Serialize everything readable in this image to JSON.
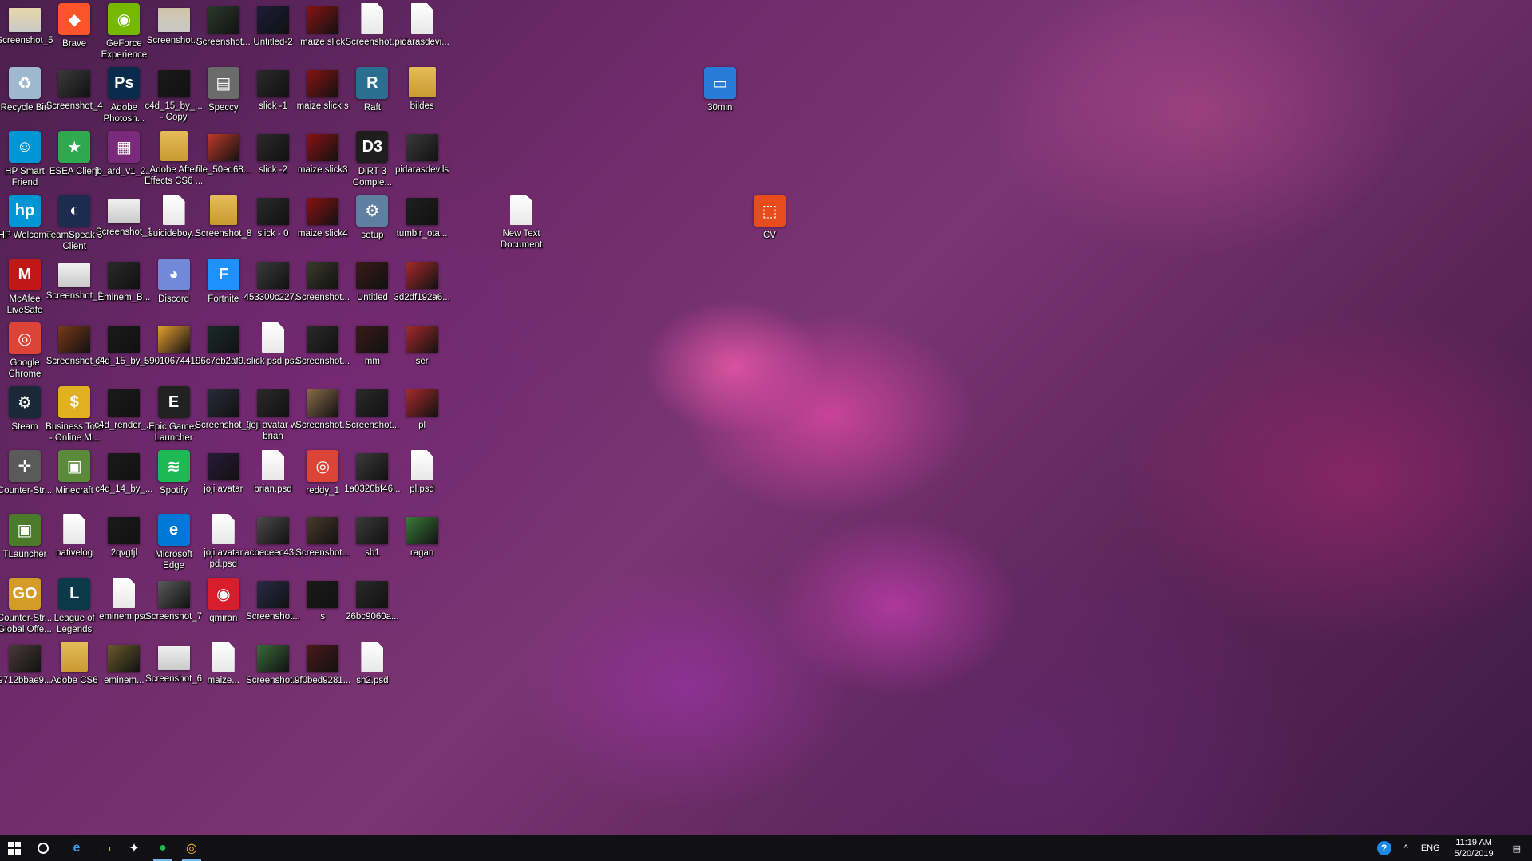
{
  "desktop": {
    "icons": [
      {
        "label": "Screenshot_5",
        "kind": "shot",
        "glyph": "",
        "color": "#e8d7a9",
        "col": 0,
        "row": 0,
        "shortcut": false
      },
      {
        "label": "Brave",
        "kind": "app",
        "glyph": "◆",
        "color": "#fb542b",
        "col": 1,
        "row": 0,
        "shortcut": true
      },
      {
        "label": "GeForce Experience",
        "kind": "app",
        "glyph": "◉",
        "color": "#76b900",
        "col": 2,
        "row": 0,
        "shortcut": true
      },
      {
        "label": "Screenshot...",
        "kind": "shot",
        "glyph": "",
        "color": "#cfc6a8",
        "col": 3,
        "row": 0,
        "shortcut": false
      },
      {
        "label": "Screenshot...",
        "kind": "img",
        "glyph": "",
        "color": "#2b3a2b",
        "col": 4,
        "row": 0,
        "shortcut": false
      },
      {
        "label": "Untitled-2",
        "kind": "img",
        "glyph": "",
        "color": "#1c1c3a",
        "col": 5,
        "row": 0,
        "shortcut": false
      },
      {
        "label": "maize slick",
        "kind": "img",
        "glyph": "",
        "color": "#8a1212",
        "col": 6,
        "row": 0,
        "shortcut": false
      },
      {
        "label": "Screenshot...",
        "kind": "doc",
        "glyph": "",
        "color": "#ffffff",
        "col": 7,
        "row": 0,
        "shortcut": false
      },
      {
        "label": "pidarasdevi...",
        "kind": "doc",
        "glyph": "",
        "color": "#ffffff",
        "col": 8,
        "row": 0,
        "shortcut": false
      },
      {
        "label": "Recycle Bin",
        "kind": "app",
        "glyph": "♻",
        "color": "#9fb7cf",
        "col": 0,
        "row": 1,
        "shortcut": false
      },
      {
        "label": "Screenshot_4",
        "kind": "img",
        "glyph": "",
        "color": "#3a3a3a",
        "col": 1,
        "row": 1,
        "shortcut": false
      },
      {
        "label": "Adobe Photosh...",
        "kind": "app",
        "glyph": "Ps",
        "color": "#0b2b4c",
        "col": 2,
        "row": 1,
        "shortcut": true
      },
      {
        "label": "c4d_15_by_... - Copy",
        "kind": "img",
        "glyph": "",
        "color": "#1a1a1a",
        "col": 3,
        "row": 1,
        "shortcut": false
      },
      {
        "label": "Speccy",
        "kind": "app",
        "glyph": "▤",
        "color": "#6b6b6b",
        "col": 4,
        "row": 1,
        "shortcut": true
      },
      {
        "label": "slick -1",
        "kind": "img",
        "glyph": "",
        "color": "#2a2a2a",
        "col": 5,
        "row": 1,
        "shortcut": false
      },
      {
        "label": "maize slick s",
        "kind": "img",
        "glyph": "",
        "color": "#8a1212",
        "col": 6,
        "row": 1,
        "shortcut": false
      },
      {
        "label": "Raft",
        "kind": "app",
        "glyph": "R",
        "color": "#2a6f8f",
        "col": 7,
        "row": 1,
        "shortcut": true
      },
      {
        "label": "bildes",
        "kind": "folder",
        "glyph": "",
        "color": "#e5bd5a",
        "col": 8,
        "row": 1,
        "shortcut": false
      },
      {
        "label": "HP Smart Friend",
        "kind": "app",
        "glyph": "☺",
        "color": "#0096d6",
        "col": 0,
        "row": 2,
        "shortcut": true
      },
      {
        "label": "ESEA Client",
        "kind": "app",
        "glyph": "★",
        "color": "#2fa84f",
        "col": 1,
        "row": 2,
        "shortcut": true
      },
      {
        "label": "jb_ard_v1_2...",
        "kind": "app",
        "glyph": "▦",
        "color": "#7a2a7a",
        "col": 2,
        "row": 2,
        "shortcut": false
      },
      {
        "label": "Adobe After Effects CS6 ...",
        "kind": "folder",
        "glyph": "",
        "color": "#e5bd5a",
        "col": 3,
        "row": 2,
        "shortcut": false
      },
      {
        "label": "file_50ed68...",
        "kind": "img",
        "glyph": "",
        "color": "#c0392b",
        "col": 4,
        "row": 2,
        "shortcut": false
      },
      {
        "label": "slick -2",
        "kind": "img",
        "glyph": "",
        "color": "#2a2a2a",
        "col": 5,
        "row": 2,
        "shortcut": false
      },
      {
        "label": "maize slick3",
        "kind": "img",
        "glyph": "",
        "color": "#8a1212",
        "col": 6,
        "row": 2,
        "shortcut": false
      },
      {
        "label": "DiRT 3 Comple...",
        "kind": "app",
        "glyph": "D3",
        "color": "#1e1e1e",
        "col": 7,
        "row": 2,
        "shortcut": true
      },
      {
        "label": "pidarasdevils",
        "kind": "img",
        "glyph": "",
        "color": "#3a3a3a",
        "col": 8,
        "row": 2,
        "shortcut": false
      },
      {
        "label": "HP Welcome",
        "kind": "app",
        "glyph": "hp",
        "color": "#0096d6",
        "col": 0,
        "row": 3,
        "shortcut": true
      },
      {
        "label": "TeamSpeak 3 Client",
        "kind": "app",
        "glyph": "◐",
        "color": "#1b2c4e",
        "col": 1,
        "row": 3,
        "shortcut": true
      },
      {
        "label": "Screenshot_1",
        "kind": "shot",
        "glyph": "",
        "color": "#f0f0f0",
        "col": 2,
        "row": 3,
        "shortcut": false
      },
      {
        "label": "suicideboy...",
        "kind": "doc",
        "glyph": "",
        "color": "#ffffff",
        "col": 3,
        "row": 3,
        "shortcut": false
      },
      {
        "label": "Screenshot_8",
        "kind": "folder",
        "glyph": "",
        "color": "#e5bd5a",
        "col": 4,
        "row": 3,
        "shortcut": false
      },
      {
        "label": "slick - 0",
        "kind": "img",
        "glyph": "",
        "color": "#2a2a2a",
        "col": 5,
        "row": 3,
        "shortcut": false
      },
      {
        "label": "maize slick4",
        "kind": "img",
        "glyph": "",
        "color": "#8a1212",
        "col": 6,
        "row": 3,
        "shortcut": false
      },
      {
        "label": "setup",
        "kind": "app",
        "glyph": "⚙",
        "color": "#5f7fa0",
        "col": 7,
        "row": 3,
        "shortcut": true
      },
      {
        "label": "tumblr_ota...",
        "kind": "img",
        "glyph": "",
        "color": "#1f1f1f",
        "col": 8,
        "row": 3,
        "shortcut": false
      },
      {
        "label": "McAfee LiveSafe",
        "kind": "app",
        "glyph": "M",
        "color": "#c01818",
        "col": 0,
        "row": 4,
        "shortcut": true
      },
      {
        "label": "Screenshot_2",
        "kind": "shot",
        "glyph": "",
        "color": "#f0f0f0",
        "col": 1,
        "row": 4,
        "shortcut": false
      },
      {
        "label": "Eminem_B...",
        "kind": "img",
        "glyph": "",
        "color": "#2a2a2a",
        "col": 2,
        "row": 4,
        "shortcut": false
      },
      {
        "label": "Discord",
        "kind": "app",
        "glyph": "◕",
        "color": "#7289da",
        "col": 3,
        "row": 4,
        "shortcut": true
      },
      {
        "label": "Fortnite",
        "kind": "app",
        "glyph": "F",
        "color": "#1e90ff",
        "col": 4,
        "row": 4,
        "shortcut": true
      },
      {
        "label": "453300c227...",
        "kind": "img",
        "glyph": "",
        "color": "#3a3a3a",
        "col": 5,
        "row": 4,
        "shortcut": false
      },
      {
        "label": "Screenshot...",
        "kind": "img",
        "glyph": "",
        "color": "#3a3a2a",
        "col": 6,
        "row": 4,
        "shortcut": false
      },
      {
        "label": "Untitled",
        "kind": "img",
        "glyph": "",
        "color": "#3a1a1a",
        "col": 7,
        "row": 4,
        "shortcut": false
      },
      {
        "label": "3d2df192a6...",
        "kind": "img",
        "glyph": "",
        "color": "#a52a2a",
        "col": 8,
        "row": 4,
        "shortcut": false
      },
      {
        "label": "Google Chrome",
        "kind": "app",
        "glyph": "◎",
        "color": "#db4437",
        "col": 0,
        "row": 5,
        "shortcut": true
      },
      {
        "label": "Screenshot_3",
        "kind": "img",
        "glyph": "",
        "color": "#7a3a1a",
        "col": 1,
        "row": 5,
        "shortcut": false
      },
      {
        "label": "c4d_15_by_...",
        "kind": "img",
        "glyph": "",
        "color": "#1a1a1a",
        "col": 2,
        "row": 5,
        "shortcut": false
      },
      {
        "label": "5901067441...",
        "kind": "img",
        "glyph": "",
        "color": "#e8a030",
        "col": 3,
        "row": 5,
        "shortcut": false
      },
      {
        "label": "96c7eb2af9...",
        "kind": "img",
        "glyph": "",
        "color": "#1a2a2a",
        "col": 4,
        "row": 5,
        "shortcut": false
      },
      {
        "label": "slick psd.psd",
        "kind": "doc",
        "glyph": "",
        "color": "#ffffff",
        "col": 5,
        "row": 5,
        "shortcut": false
      },
      {
        "label": "Screenshot...",
        "kind": "img",
        "glyph": "",
        "color": "#2a2a2a",
        "col": 6,
        "row": 5,
        "shortcut": false
      },
      {
        "label": "mm",
        "kind": "img",
        "glyph": "",
        "color": "#3a1a1a",
        "col": 7,
        "row": 5,
        "shortcut": false
      },
      {
        "label": "ser",
        "kind": "img",
        "glyph": "",
        "color": "#a52a2a",
        "col": 8,
        "row": 5,
        "shortcut": false
      },
      {
        "label": "Steam",
        "kind": "app",
        "glyph": "⚙",
        "color": "#1b2838",
        "col": 0,
        "row": 6,
        "shortcut": true
      },
      {
        "label": "Business Tour - Online M...",
        "kind": "app",
        "glyph": "$",
        "color": "#e0b020",
        "col": 1,
        "row": 6,
        "shortcut": true
      },
      {
        "label": "c4d_render_...",
        "kind": "img",
        "glyph": "",
        "color": "#1a1a1a",
        "col": 2,
        "row": 6,
        "shortcut": false
      },
      {
        "label": "Epic Games Launcher",
        "kind": "app",
        "glyph": "E",
        "color": "#222222",
        "col": 3,
        "row": 6,
        "shortcut": true
      },
      {
        "label": "Screenshot_9",
        "kind": "img",
        "glyph": "",
        "color": "#2a2a3a",
        "col": 4,
        "row": 6,
        "shortcut": false
      },
      {
        "label": "joji avatar w brian",
        "kind": "img",
        "glyph": "",
        "color": "#2a2a2a",
        "col": 5,
        "row": 6,
        "shortcut": false
      },
      {
        "label": "Screenshot...",
        "kind": "img",
        "glyph": "",
        "color": "#8a6a4a",
        "col": 6,
        "row": 6,
        "shortcut": false
      },
      {
        "label": "Screenshot...",
        "kind": "img",
        "glyph": "",
        "color": "#2a2a2a",
        "col": 7,
        "row": 6,
        "shortcut": false
      },
      {
        "label": "pl",
        "kind": "img",
        "glyph": "",
        "color": "#a52a2a",
        "col": 8,
        "row": 6,
        "shortcut": false
      },
      {
        "label": "Counter-Str...",
        "kind": "app",
        "glyph": "✛",
        "color": "#5a5a5a",
        "col": 0,
        "row": 7,
        "shortcut": true
      },
      {
        "label": "Minecraft",
        "kind": "app",
        "glyph": "▣",
        "color": "#5a8a3a",
        "col": 1,
        "row": 7,
        "shortcut": true
      },
      {
        "label": "c4d_14_by_...",
        "kind": "img",
        "glyph": "",
        "color": "#1a1a1a",
        "col": 2,
        "row": 7,
        "shortcut": false
      },
      {
        "label": "Spotify",
        "kind": "app",
        "glyph": "≋",
        "color": "#1db954",
        "col": 3,
        "row": 7,
        "shortcut": true
      },
      {
        "label": "joji avatar",
        "kind": "img",
        "glyph": "",
        "color": "#2a1a3a",
        "col": 4,
        "row": 7,
        "shortcut": false
      },
      {
        "label": "brian.psd",
        "kind": "doc",
        "glyph": "",
        "color": "#ffffff",
        "col": 5,
        "row": 7,
        "shortcut": false
      },
      {
        "label": "reddy_1",
        "kind": "app",
        "glyph": "◎",
        "color": "#db4437",
        "col": 6,
        "row": 7,
        "shortcut": false
      },
      {
        "label": "1a0320bf46...",
        "kind": "img",
        "glyph": "",
        "color": "#3a3a3a",
        "col": 7,
        "row": 7,
        "shortcut": false
      },
      {
        "label": "pl.psd",
        "kind": "doc",
        "glyph": "",
        "color": "#ffffff",
        "col": 8,
        "row": 7,
        "shortcut": false
      },
      {
        "label": "TLauncher",
        "kind": "app",
        "glyph": "▣",
        "color": "#4a7a2a",
        "col": 0,
        "row": 8,
        "shortcut": true
      },
      {
        "label": "nativelog",
        "kind": "doc",
        "glyph": "",
        "color": "#ffffff",
        "col": 1,
        "row": 8,
        "shortcut": false
      },
      {
        "label": "2qvgtjl",
        "kind": "img",
        "glyph": "",
        "color": "#1a1a1a",
        "col": 2,
        "row": 8,
        "shortcut": false
      },
      {
        "label": "Microsoft Edge",
        "kind": "app",
        "glyph": "e",
        "color": "#0078d7",
        "col": 3,
        "row": 8,
        "shortcut": true
      },
      {
        "label": "joji avatar pd.psd",
        "kind": "doc",
        "glyph": "",
        "color": "#ffffff",
        "col": 4,
        "row": 8,
        "shortcut": false
      },
      {
        "label": "acbeceec43...",
        "kind": "img",
        "glyph": "",
        "color": "#4a4a4a",
        "col": 5,
        "row": 8,
        "shortcut": false
      },
      {
        "label": "Screenshot...",
        "kind": "img",
        "glyph": "",
        "color": "#4a3a2a",
        "col": 6,
        "row": 8,
        "shortcut": false
      },
      {
        "label": "sb1",
        "kind": "img",
        "glyph": "",
        "color": "#3a3a3a",
        "col": 7,
        "row": 8,
        "shortcut": false
      },
      {
        "label": "ragan",
        "kind": "img",
        "glyph": "",
        "color": "#3a7a3a",
        "col": 8,
        "row": 8,
        "shortcut": false
      },
      {
        "label": "Counter-Str... Global Offe...",
        "kind": "app",
        "glyph": "GO",
        "color": "#d49a2a",
        "col": 0,
        "row": 9,
        "shortcut": true
      },
      {
        "label": "League of Legends",
        "kind": "app",
        "glyph": "L",
        "color": "#0a3a4a",
        "col": 1,
        "row": 9,
        "shortcut": true
      },
      {
        "label": "eminem.psd",
        "kind": "doc",
        "glyph": "",
        "color": "#ffffff",
        "col": 2,
        "row": 9,
        "shortcut": false
      },
      {
        "label": "Screenshot_7",
        "kind": "img",
        "glyph": "",
        "color": "#5a5a5a",
        "col": 3,
        "row": 9,
        "shortcut": false
      },
      {
        "label": "qmiran",
        "kind": "app",
        "glyph": "◉",
        "color": "#d81e2a",
        "col": 4,
        "row": 9,
        "shortcut": false
      },
      {
        "label": "Screenshot...",
        "kind": "img",
        "glyph": "",
        "color": "#2a2a4a",
        "col": 5,
        "row": 9,
        "shortcut": false
      },
      {
        "label": "s",
        "kind": "img",
        "glyph": "",
        "color": "#1a1a1a",
        "col": 6,
        "row": 9,
        "shortcut": false
      },
      {
        "label": "26bc9060a...",
        "kind": "img",
        "glyph": "",
        "color": "#2a2a2a",
        "col": 7,
        "row": 9,
        "shortcut": false
      },
      {
        "label": "9712bbae9...",
        "kind": "img",
        "glyph": "",
        "color": "#4a3a3a",
        "col": 0,
        "row": 10,
        "shortcut": false
      },
      {
        "label": "Adobe CS6",
        "kind": "folder",
        "glyph": "",
        "color": "#e5bd5a",
        "col": 1,
        "row": 10,
        "shortcut": false
      },
      {
        "label": "eminem...",
        "kind": "img",
        "glyph": "",
        "color": "#6a5a2a",
        "col": 2,
        "row": 10,
        "shortcut": false
      },
      {
        "label": "Screenshot_6",
        "kind": "shot",
        "glyph": "",
        "color": "#f0f0f0",
        "col": 3,
        "row": 10,
        "shortcut": false
      },
      {
        "label": "maize...",
        "kind": "doc",
        "glyph": "",
        "color": "#ffffff",
        "col": 4,
        "row": 10,
        "shortcut": false
      },
      {
        "label": "Screenshot...",
        "kind": "img",
        "glyph": "",
        "color": "#3a6a3a",
        "col": 5,
        "row": 10,
        "shortcut": false
      },
      {
        "label": "9f0bed9281...",
        "kind": "img",
        "glyph": "",
        "color": "#4a1a1a",
        "col": 6,
        "row": 10,
        "shortcut": false
      },
      {
        "label": "sh2.psd",
        "kind": "doc",
        "glyph": "",
        "color": "#ffffff",
        "col": 7,
        "row": 10,
        "shortcut": false
      },
      {
        "label": "New Text Document",
        "kind": "doc",
        "glyph": "",
        "color": "#ffffff",
        "col": 10,
        "row": 3,
        "shortcut": false
      },
      {
        "label": "30min",
        "kind": "app",
        "glyph": "▭",
        "color": "#2a7ad8",
        "col": 14,
        "row": 1,
        "shortcut": true
      },
      {
        "label": "CV",
        "kind": "app",
        "glyph": "⬚",
        "color": "#e74c1c",
        "col": 15,
        "row": 3,
        "shortcut": false
      }
    ]
  },
  "taskbar": {
    "start_icon": "windows-start-icon",
    "search_icon": "cortana-circle-icon",
    "pinned": [
      {
        "name": "edge-taskbar-icon",
        "glyph": "e",
        "color": "#3a9be8",
        "active": false
      },
      {
        "name": "file-explorer-taskbar-icon",
        "glyph": "▭",
        "color": "#f3c94a",
        "active": false
      },
      {
        "name": "dropbox-taskbar-icon",
        "glyph": "✦",
        "color": "#ffffff",
        "active": false
      },
      {
        "name": "spotify-taskbar-icon",
        "glyph": "●",
        "color": "#1db954",
        "active": true
      },
      {
        "name": "chrome-taskbar-icon",
        "glyph": "◎",
        "color": "#f2b632",
        "active": true
      }
    ],
    "tray": {
      "help_glyph": "?",
      "chevron_glyph": "^",
      "language": "ENG",
      "time": "11:19 AM",
      "date": "5/20/2019",
      "notification_glyph": "▤"
    }
  }
}
